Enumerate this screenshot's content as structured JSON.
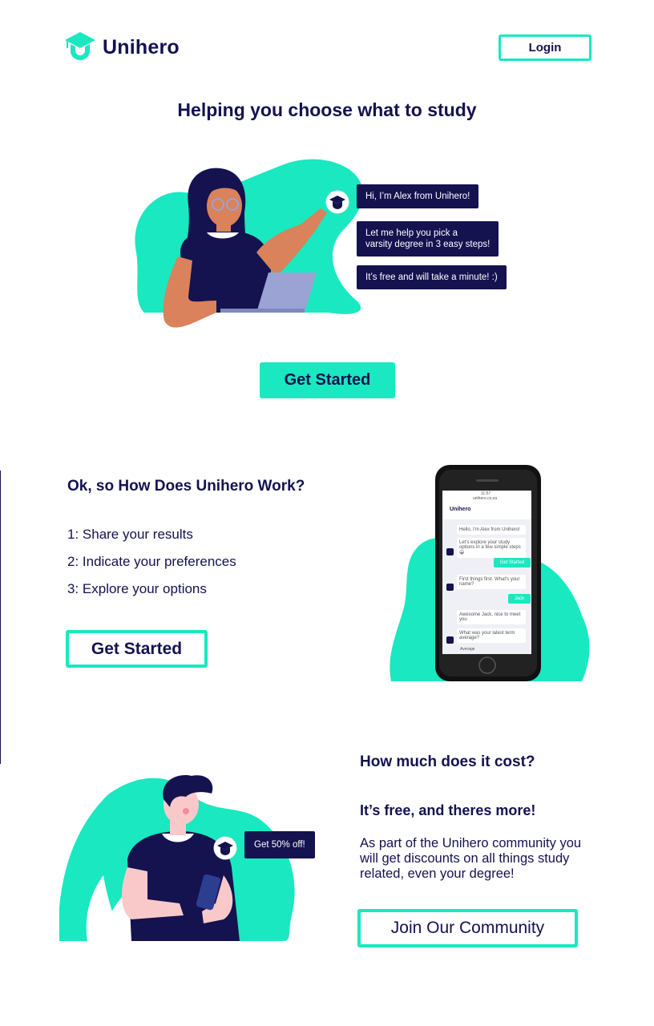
{
  "header": {
    "logo_text": "Unihero",
    "login_label": "Login"
  },
  "hero": {
    "title": "Helping you choose what to study",
    "bubbles": [
      "Hi, I’m Alex from Unihero!",
      "Let me help you pick a\nvarsity degree in 3 easy steps!",
      "It’s free and will take a minute! :)"
    ],
    "cta_label": "Get Started"
  },
  "how": {
    "title": "Ok, so How Does Unihero Work?",
    "steps": [
      "1: Share your results",
      "2: Indicate your preferences",
      "3: Explore your options"
    ],
    "cta_label": "Get Started",
    "phone": {
      "app_name": "Unihero",
      "status_time": "11:57",
      "url": "unihero.co.za",
      "messages": [
        {
          "from": "bot",
          "text": "Hello, I'm Alex from Unihero!"
        },
        {
          "from": "bot",
          "text": "Let's explore your study options in a few simple steps 😀"
        },
        {
          "from": "user",
          "text": "Get Started"
        },
        {
          "from": "bot",
          "text": "First things first. What's your name?"
        },
        {
          "from": "user",
          "text": "Jack"
        },
        {
          "from": "bot",
          "text": "Awesome Jack, nice to meet you"
        },
        {
          "from": "bot",
          "text": "What was your latest term average?"
        }
      ],
      "input_text": "Average"
    }
  },
  "cost": {
    "title": "How much does it cost?",
    "subtitle": "It’s free, and theres more!",
    "body": "As part of the Unihero community you will get discounts on all things study related, even your degree!",
    "bubble": "Get 50% off!",
    "cta_label": "Join Our Community"
  },
  "colors": {
    "accent": "#19e8c0",
    "navy": "#14124f",
    "skin": "#d9825b",
    "laptop": "#9aa3d3"
  },
  "icons": [
    "graduation-cap-icon"
  ]
}
